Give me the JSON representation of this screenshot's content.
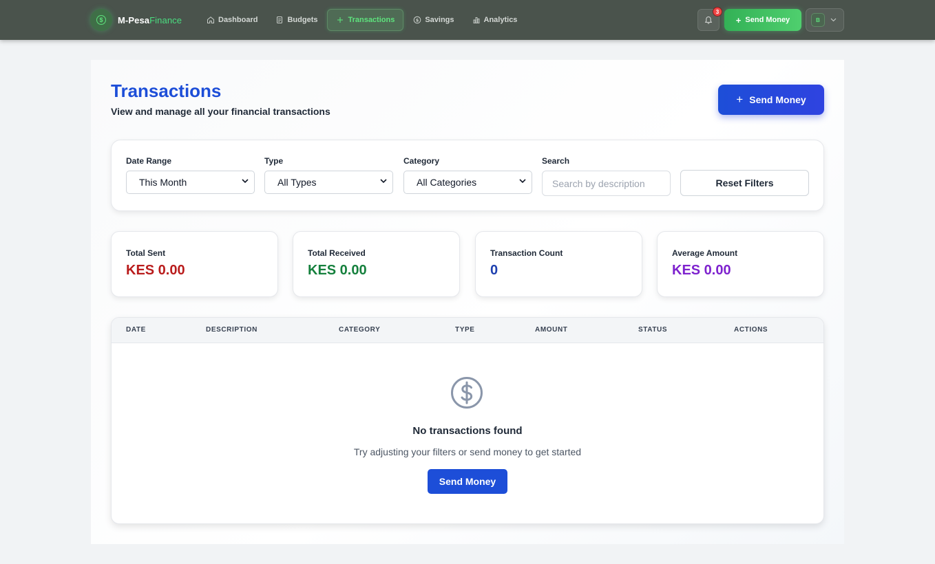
{
  "colors": {
    "accent_green": "#4ade80",
    "primary_blue": "#1d4ed8",
    "sent_red": "#b91c1c",
    "received_green": "#15803d",
    "count_blue": "#1e40af",
    "average_purple": "#7e22ce"
  },
  "brand": {
    "name": "M-Pesa",
    "accent": "Finance",
    "icon": "dollar-circle-icon"
  },
  "nav": {
    "dashboard": {
      "label": "Dashboard",
      "icon": "home-icon"
    },
    "budgets": {
      "label": "Budgets",
      "icon": "document-icon"
    },
    "transactions": {
      "label": "Transactions",
      "icon": "plus-icon",
      "active": true
    },
    "savings": {
      "label": "Savings",
      "icon": "dollar-circle-icon"
    },
    "analytics": {
      "label": "Analytics",
      "icon": "bar-chart-icon"
    }
  },
  "notifications": {
    "count": "3",
    "icon": "bell-icon"
  },
  "top_send": {
    "label": "Send Money",
    "icon": "plus-icon"
  },
  "user": {
    "initial": "B",
    "icon": "chevron-down-icon"
  },
  "page": {
    "title": "Transactions",
    "subtitle": "View and manage all your financial transactions",
    "send_label": "Send Money"
  },
  "filters": {
    "date_range": {
      "label": "Date Range",
      "value": "This Month"
    },
    "type": {
      "label": "Type",
      "value": "All Types"
    },
    "category": {
      "label": "Category",
      "value": "All Categories"
    },
    "search": {
      "label": "Search",
      "placeholder": "Search by description",
      "value": ""
    },
    "reset_label": "Reset Filters"
  },
  "stats": {
    "sent": {
      "label": "Total Sent",
      "value": "KES 0.00"
    },
    "received": {
      "label": "Total Received",
      "value": "KES 0.00"
    },
    "count": {
      "label": "Transaction Count",
      "value": "0"
    },
    "average": {
      "label": "Average Amount",
      "value": "KES 0.00"
    }
  },
  "table": {
    "columns": {
      "date": "DATE",
      "description": "DESCRIPTION",
      "category": "CATEGORY",
      "type": "TYPE",
      "amount": "AMOUNT",
      "status": "STATUS",
      "actions": "ACTIONS"
    },
    "rows": [],
    "empty": {
      "icon": "dollar-circle-icon",
      "title": "No transactions found",
      "subtitle": "Try adjusting your filters or send money to get started",
      "button_label": "Send Money"
    }
  }
}
